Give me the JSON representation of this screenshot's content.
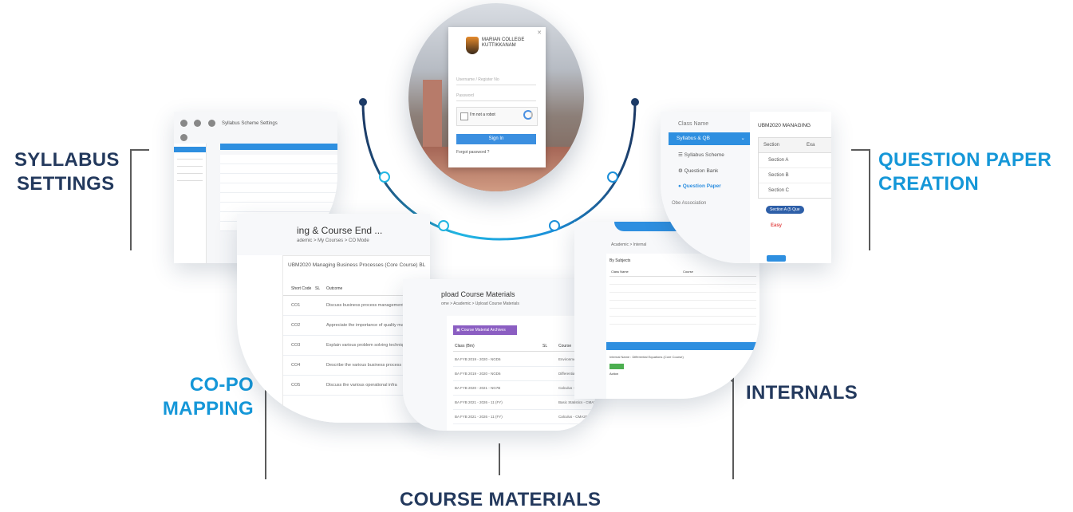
{
  "labels": {
    "syllabus_l1": "SYLLABUS",
    "syllabus_l2": "SETTINGS",
    "qp_l1": "QUESTION PAPER",
    "qp_l2": "CREATION",
    "copo_l1": "CO-PO",
    "copo_l2": "MAPPING",
    "internals": "INTERNALS",
    "course_materials": "COURSE MATERIALS"
  },
  "login": {
    "college_l1": "MARIAN COLLEGE",
    "college_l2": "KUTTIKKANAM",
    "username_placeholder": "Username / Register No",
    "password_placeholder": "Password",
    "captcha_text": "I'm not a robot",
    "sign_in": "Sign In",
    "forgot": "Forgot password ?"
  },
  "syllabus_card": {
    "title": "Syllabus Scheme Settings"
  },
  "copo_card": {
    "title": "ing & Course End ...",
    "breadcrumb": "ademic  >  My Courses  >  CO Mode",
    "course": "UBM2020 Managing Business Processes (Core Course) BL",
    "col_code": "Short Code",
    "col_sl": "SL",
    "col_outcome": "Outcome",
    "rows": [
      {
        "code": "CO1",
        "text": "Discuss business process management, Assess"
      },
      {
        "code": "CO2",
        "text": "Appreciate the importance of quality manage"
      },
      {
        "code": "CO3",
        "text": "Explain various problem solving technique"
      },
      {
        "code": "CO4",
        "text": "Describe the various business process"
      },
      {
        "code": "CO5",
        "text": "Discuss the various operational infra"
      }
    ]
  },
  "materials_card": {
    "title": "pload Course Materials",
    "breadcrumb": "ome  >  Academic  >  Upload Course Materials",
    "button": "Course Material Archives",
    "col_class": "Class (Bm)",
    "col_sl": "SL",
    "col_course": "Course",
    "rows": [
      {
        "cls": "BA FYB 2019 - 2020 - NGD6",
        "course": "Environmental Studi"
      },
      {
        "cls": "BA FYB 2019 - 2020 - NGD6",
        "course": "Differential Equations"
      },
      {
        "cls": "BA FYB 2020 - 2021 - NG7B",
        "course": "Calculus - CMA2016"
      },
      {
        "cls": "BA FYB 2021 - 2026 - 11 (FY)",
        "course": "Basic Statistics - CMA2016"
      },
      {
        "cls": "BA FYB 2021 - 2026 - 11 (FY)",
        "course": "Calculus - CMA2016"
      }
    ]
  },
  "qp_card": {
    "class_name": "Class Name",
    "menu_active": "Syllabus & QB",
    "menu_items": [
      "Syllabus Scheme",
      "Question Bank",
      "Question Paper"
    ],
    "menu_more": "Obe Association",
    "header": "UBM2020 MANAGING",
    "section_col": "Section",
    "section_col2": "Exa",
    "sections": [
      "Section A",
      "Section B",
      "Section C"
    ],
    "tag": "Section A (5 Que",
    "easy": "Easy"
  },
  "internals_card": {
    "breadcrumb": "Academic  >  Internal",
    "section": "By Subjects",
    "col_class": "Class Name",
    "col_course": "Course",
    "footer_line": "Internal Name : Differential Equations (Core Course)",
    "add": "Action"
  },
  "colors": {
    "navy": "#23395d",
    "accent_blue": "#1597d8",
    "sign_in": "#3b8fe0",
    "purple": "#8b5ec2"
  }
}
